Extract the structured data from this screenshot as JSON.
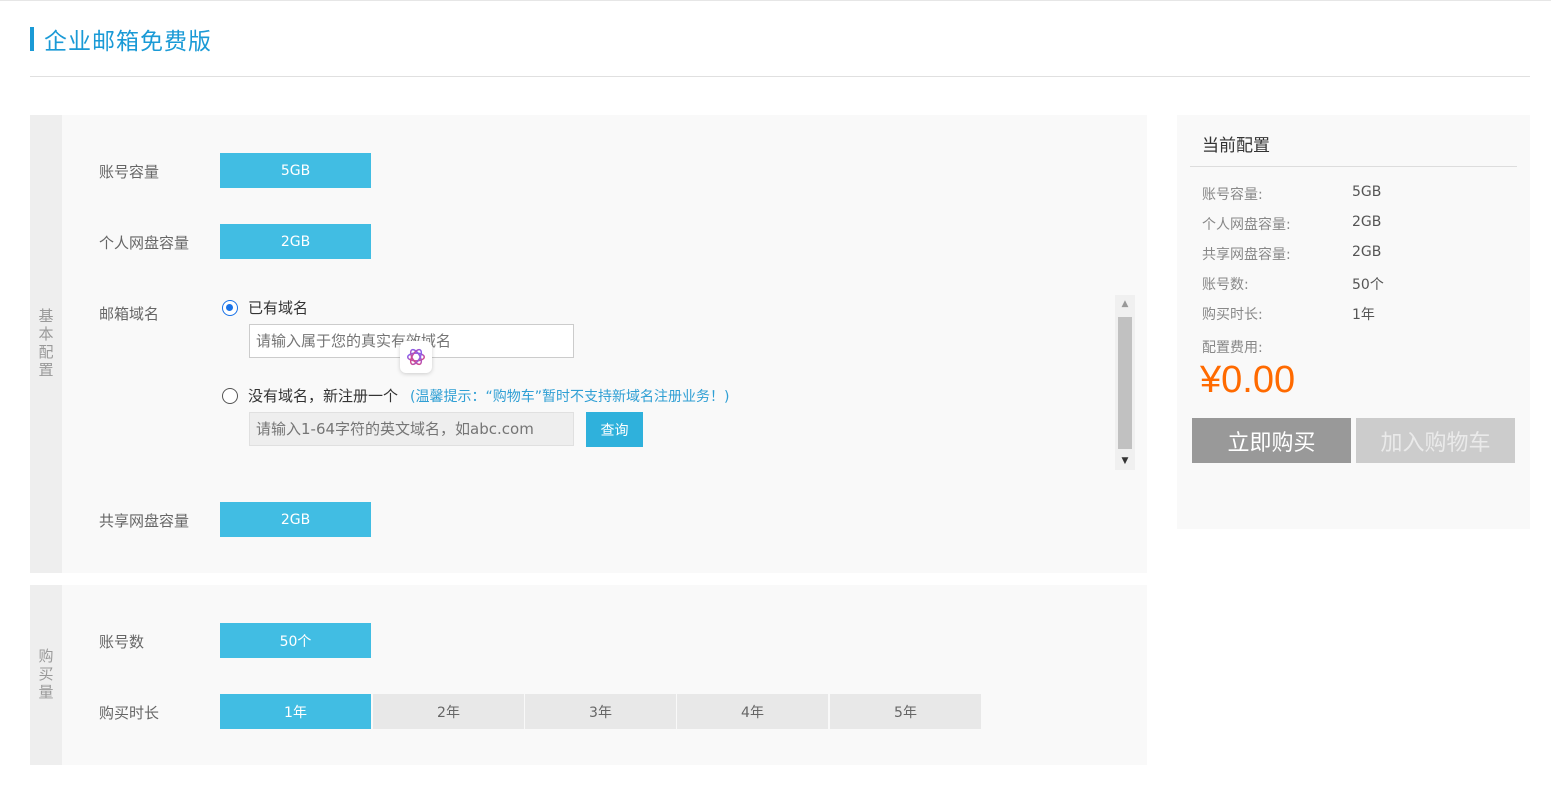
{
  "page": {
    "title": "企业邮箱免费版"
  },
  "basic": {
    "side_label": "基本配置",
    "account_capacity": {
      "label": "账号容量",
      "value": "5GB"
    },
    "personal_disk": {
      "label": "个人网盘容量",
      "value": "2GB"
    },
    "domain": {
      "label": "邮箱域名",
      "option_existing": "已有域名",
      "existing_placeholder": "请输入属于您的真实有效域名",
      "option_new": "没有域名，新注册一个",
      "hint": "(温馨提示：“购物车”暂时不支持新域名注册业务！)",
      "new_placeholder": "请输入1-64字符的英文域名，如abc.com",
      "query_label": "查询",
      "selected": "existing"
    },
    "shared_disk": {
      "label": "共享网盘容量",
      "value": "2GB"
    }
  },
  "quantity": {
    "side_label": "购买量",
    "accounts": {
      "label": "账号数",
      "value": "50个"
    },
    "duration": {
      "label": "购买时长",
      "options": [
        "1年",
        "2年",
        "3年",
        "4年",
        "5年"
      ],
      "selected": "1年"
    }
  },
  "summary": {
    "title": "当前配置",
    "rows": [
      {
        "key": "账号容量:",
        "value": "5GB"
      },
      {
        "key": "个人网盘容量:",
        "value": "2GB"
      },
      {
        "key": "共享网盘容量:",
        "value": "2GB"
      },
      {
        "key": "账号数:",
        "value": "50个"
      },
      {
        "key": "购买时长:",
        "value": "1年"
      }
    ],
    "cost_label": "配置费用:",
    "price": "¥0.00",
    "buy_label": "立即购买",
    "cart_label": "加入购物车"
  },
  "colors": {
    "accent": "#41bde3",
    "title": "#1a9ad6",
    "price": "#ff6a00",
    "hint": "#2f9fd4"
  },
  "icons": {
    "overlay_badge": "ai-assistant-icon",
    "scroll_up": "scroll-up-arrow-icon",
    "scroll_down": "scroll-down-arrow-icon"
  }
}
